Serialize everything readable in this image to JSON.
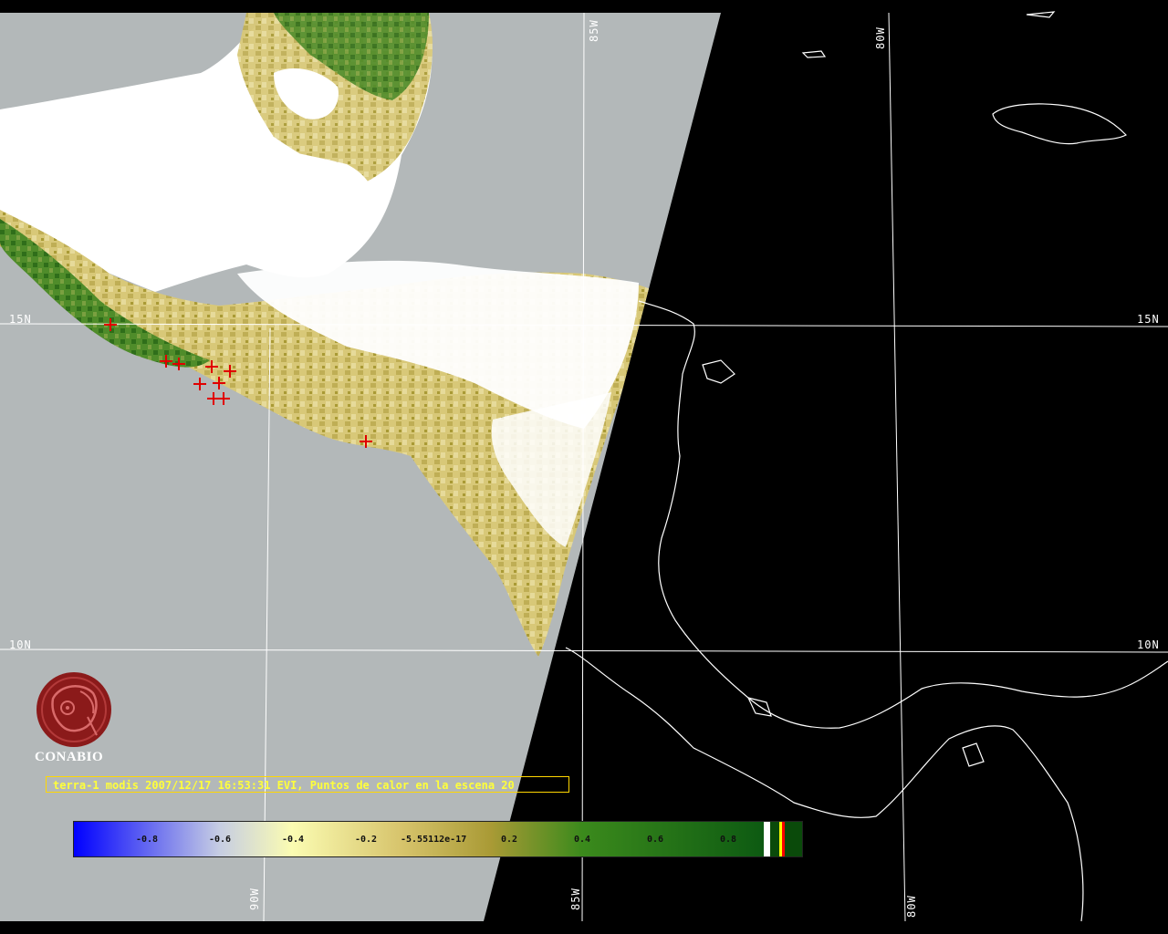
{
  "map": {
    "lat_labels": [
      {
        "text": "15N"
      },
      {
        "text": "15N"
      },
      {
        "text": "10N"
      },
      {
        "text": "10N"
      }
    ],
    "lon_labels": [
      {
        "text": "85W"
      },
      {
        "text": "80W"
      },
      {
        "text": "90W"
      },
      {
        "text": "85W"
      },
      {
        "text": "80W"
      }
    ],
    "fire_points_count_shown": 11,
    "colors": {
      "ocean_day": "#b3b8b9",
      "night": "#000000",
      "cloud": "#ffffff",
      "graticule": "#ffffff",
      "fire": "#e00000"
    }
  },
  "logo": {
    "name": "CONABIO",
    "color": "#8b1a1a"
  },
  "caption": "terra-1 modis 2007/12/17 16:53:31 EVI, Puntos de calor en la escena 20",
  "colorbar": {
    "ticks": [
      "-0.8",
      "-0.6",
      "-0.4",
      "-0.2",
      "-5.55112e-17",
      "0.2",
      "0.4",
      "0.6",
      "0.8"
    ],
    "stops": [
      {
        "value": -1.0,
        "color": "#0000ff"
      },
      {
        "value": -0.6,
        "color": "#c6cde3"
      },
      {
        "value": -0.4,
        "color": "#fbfcb2"
      },
      {
        "value": -0.1,
        "color": "#d7c46c"
      },
      {
        "value": 0.15,
        "color": "#a99a35"
      },
      {
        "value": 0.4,
        "color": "#3b8a1c"
      },
      {
        "value": 0.9,
        "color": "#0d5a12"
      }
    ]
  }
}
